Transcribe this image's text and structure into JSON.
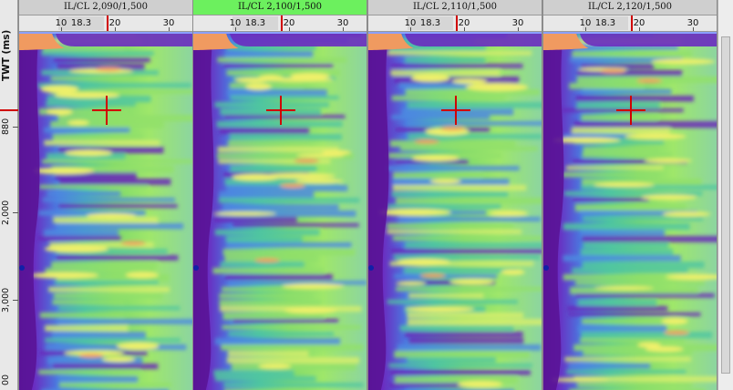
{
  "axis": {
    "title": "TWT (ms)",
    "ticks": [
      "880",
      "2,000",
      "3,000",
      "00"
    ]
  },
  "ruler": {
    "labels": [
      "10",
      "20",
      "30"
    ],
    "current_value": "18.3"
  },
  "panels": [
    {
      "title": "IL/CL 2,090/1,500",
      "active": false
    },
    {
      "title": "IL/CL 2,100/1,500",
      "active": true
    },
    {
      "title": "IL/CL 2,110/1,500",
      "active": false
    },
    {
      "title": "IL/CL 2,120/1,500",
      "active": false
    }
  ],
  "colors": {
    "active_header": "#6cf05e",
    "cursor": "#d00000",
    "low": "#5a1aa0",
    "mid": "#49c1a3",
    "high": "#f3f36a",
    "peak": "#f0a060"
  },
  "icons": {
    "crosshair": "crosshair-icon",
    "well_marker": "well-marker-icon"
  }
}
